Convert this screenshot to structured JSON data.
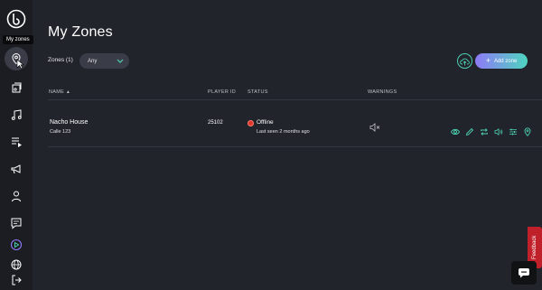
{
  "sidebar": {
    "tooltip": "My zones",
    "items": [
      {
        "icon": "zones-pin-icon"
      },
      {
        "icon": "media-library-icon"
      },
      {
        "icon": "music-note-icon"
      },
      {
        "icon": "playlist-icon"
      },
      {
        "icon": "megaphone-icon"
      },
      {
        "icon": "user-icon"
      },
      {
        "icon": "chat-icon"
      },
      {
        "icon": "play-circle-icon"
      },
      {
        "icon": "globe-icon"
      },
      {
        "icon": "logout-icon"
      }
    ]
  },
  "page": {
    "title": "My Zones",
    "zones_count_label": "Zones (1)",
    "filter_value": "Any",
    "add_zone_label": "Add zone"
  },
  "table": {
    "headers": {
      "name": "NAME",
      "player_id": "PLAYER ID",
      "status": "STATUS",
      "warnings": "WARNINGS"
    },
    "rows": [
      {
        "name": "Nacho House",
        "address": "Calle 123",
        "player_id": "25102",
        "status": "Offline",
        "last_seen": "Last seen 2 months ago"
      }
    ]
  },
  "feedback_label": "Feedback",
  "colors": {
    "background": "#22242c",
    "accent_teal": "#4dd0b0",
    "accent_purple": "#8e7af6",
    "status_offline": "#e0352b"
  }
}
